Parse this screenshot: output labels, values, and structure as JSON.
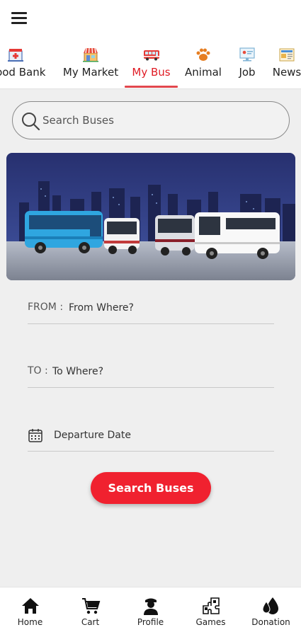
{
  "header": {
    "tabs": [
      {
        "label": "Blood Bank",
        "icon": "hospital-icon"
      },
      {
        "label": "My Market",
        "icon": "market-icon"
      },
      {
        "label": "My Bus",
        "icon": "bus-icon",
        "active": true
      },
      {
        "label": "Animal",
        "icon": "paw-icon"
      },
      {
        "label": "Job",
        "icon": "job-icon"
      },
      {
        "label": "News",
        "icon": "news-icon"
      }
    ],
    "active_color": "#e01b24"
  },
  "search": {
    "placeholder": "Search Buses"
  },
  "form": {
    "from_label": "FROM :",
    "from_placeholder": "From Where?",
    "to_label": "TO :",
    "to_placeholder": "To Where?",
    "date_placeholder": "Departure Date",
    "submit_label": "Search Buses",
    "submit_color": "#f0212f"
  },
  "bottom_nav": [
    {
      "label": "Home",
      "icon": "home-icon"
    },
    {
      "label": "Cart",
      "icon": "cart-icon"
    },
    {
      "label": "Profile",
      "icon": "profile-icon"
    },
    {
      "label": "Games",
      "icon": "games-icon"
    },
    {
      "label": "Donation",
      "icon": "donation-icon"
    }
  ]
}
